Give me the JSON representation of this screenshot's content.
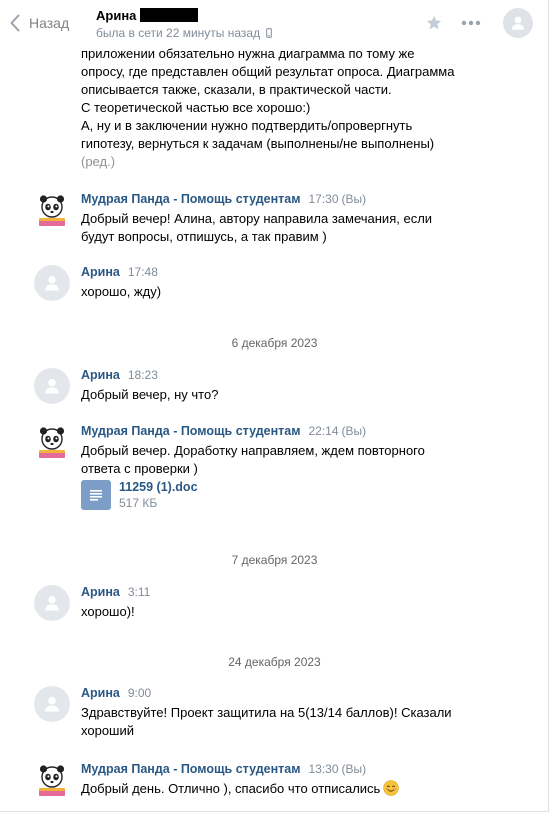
{
  "header": {
    "back_label": "Назад",
    "contact_name": "Арина",
    "status": "была в сети 22 минуты назад"
  },
  "continued_message": {
    "lines": [
      "приложении обязательно нужна диаграмма по тому же",
      "опросу, где представлен общий результат опроса. Диаграмма",
      "описывается также, сказали, в практической части.",
      "С теоретической частью все хорошо:)",
      "А, ну и в заключении нужно подтвердить/опровергнуть",
      "гипотезу, вернуться к задачам (выполнены/не выполнены)"
    ],
    "edited": "(ред.)"
  },
  "messages": [
    {
      "author": "Мудрая Панда - Помощь студентам",
      "time": "17:30",
      "you": "(Вы)",
      "lines": [
        "Добрый вечер! Алина, автору направила замечания, если",
        "будут вопросы, отпишусь, а так правим )"
      ]
    },
    {
      "author": "Арина",
      "time": "17:48",
      "lines": [
        "хорошо, жду)"
      ]
    },
    {
      "author": "Арина",
      "time": "18:23",
      "lines": [
        "Добрый вечер, ну что?"
      ]
    },
    {
      "author": "Мудрая Панда - Помощь студентам",
      "time": "22:14",
      "you": "(Вы)",
      "lines": [
        "Добрый вечер. Доработку направляем, ждем повторного",
        "ответа с проверки )"
      ],
      "attachment": {
        "name": "11259 (1).doc",
        "size": "517 КБ",
        "icon": "document-icon"
      }
    },
    {
      "author": "Арина",
      "time": "3:11",
      "lines": [
        "хорошо)!"
      ]
    },
    {
      "author": "Арина",
      "time": "9:00",
      "lines": [
        "Здравствуйте! Проект защитила на 5(13/14 баллов)! Сказали",
        "хороший"
      ]
    },
    {
      "author": "Мудрая Панда - Помощь студентам",
      "time": "13:30",
      "you": "(Вы)",
      "lines": [
        "Добрый день. Отлично ), спасибо что отписались"
      ],
      "emoji": "blushing-smile-emoji"
    }
  ],
  "date_separators": [
    "6 декабря 2023",
    "7 декабря 2023",
    "24 декабря 2023"
  ],
  "colors": {
    "link": "#2a5885",
    "meta": "#818c99",
    "doc_icon": "#7c9dc5"
  }
}
